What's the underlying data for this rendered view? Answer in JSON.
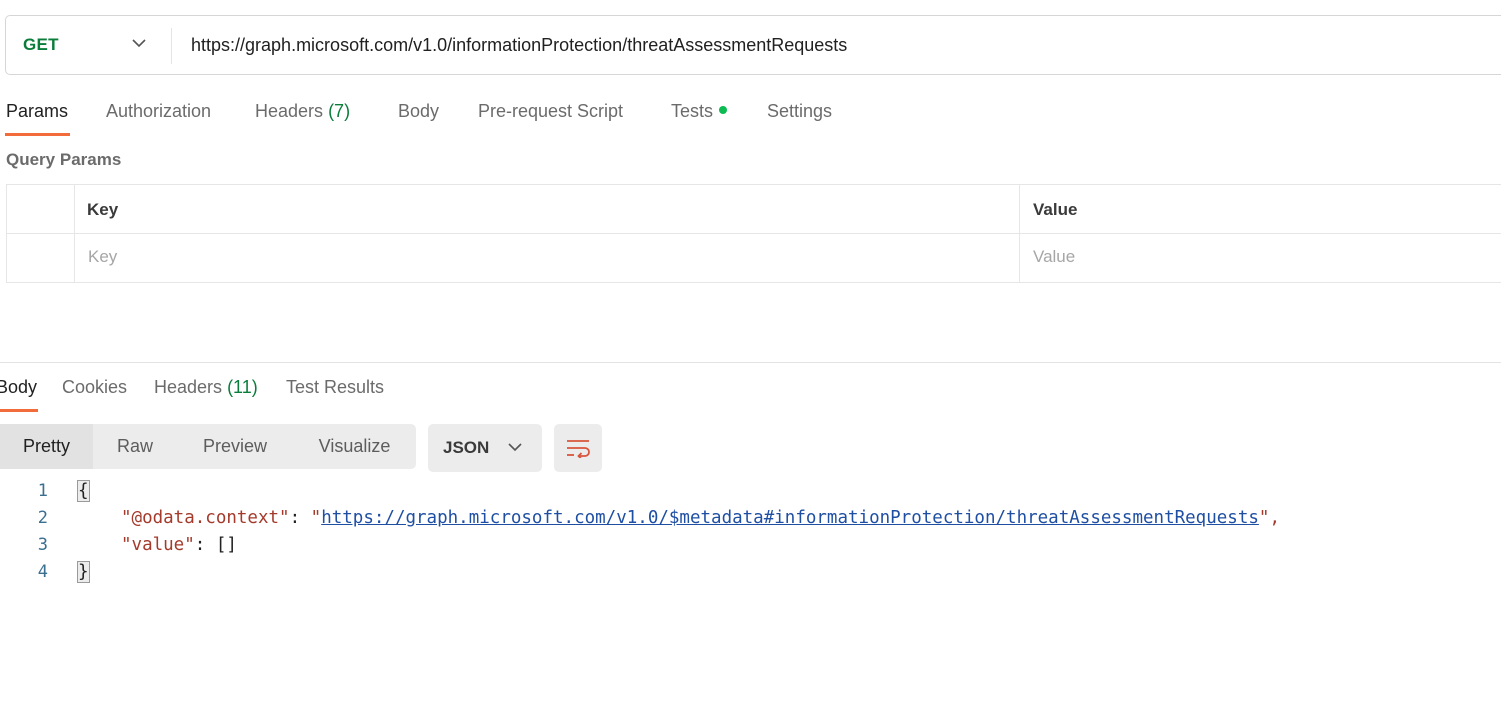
{
  "request": {
    "method": "GET",
    "url": "https://graph.microsoft.com/v1.0/informationProtection/threatAssessmentRequests"
  },
  "request_tabs": {
    "params": "Params",
    "authorization": "Authorization",
    "headers": "Headers",
    "headers_count": "(7)",
    "body": "Body",
    "prerequest": "Pre-request Script",
    "tests": "Tests",
    "settings": "Settings"
  },
  "query_params": {
    "title": "Query Params",
    "col_key": "Key",
    "col_value": "Value",
    "key_placeholder": "Key",
    "value_placeholder": "Value"
  },
  "response_tabs": {
    "body": "Body",
    "cookies": "Cookies",
    "headers": "Headers",
    "headers_count": "(11)",
    "test_results": "Test Results"
  },
  "view_modes": {
    "pretty": "Pretty",
    "raw": "Raw",
    "preview": "Preview",
    "visualize": "Visualize"
  },
  "format": "JSON",
  "editor": {
    "line_numbers": [
      "1",
      "2",
      "3",
      "4"
    ],
    "open_brace": "{",
    "close_brace": "}",
    "context_key": "\"@odata.context\"",
    "colon": ": ",
    "quote": "\"",
    "context_url": "https://graph.microsoft.com/v1.0/$metadata#informationProtection/threatAssessmentRequests",
    "trailing": "\",",
    "value_key": "\"value\"",
    "value_val": "[]"
  },
  "colors": {
    "accent": "#f26b3a",
    "method_green": "#0b7d3b",
    "dot_green": "#0cbb52"
  }
}
